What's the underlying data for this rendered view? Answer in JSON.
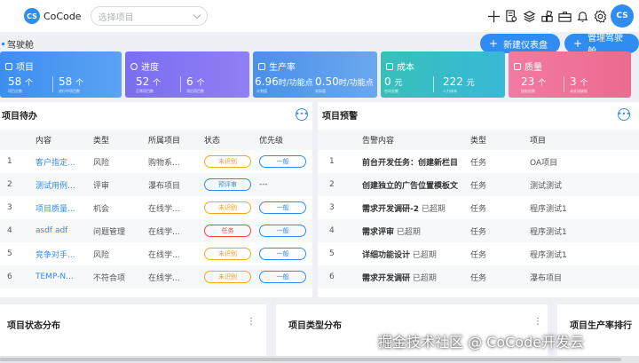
{
  "header": {
    "logo_mark": "CS",
    "app_name": "CoCode",
    "project_select_placeholder": "选择项目",
    "avatar_text": "CS"
  },
  "breadcrumb": {
    "title": "驾驶舱"
  },
  "actions": {
    "new_dashboard": "新建仪表盘",
    "manage_cockpit": "管理驾驶舱"
  },
  "stats": {
    "project": {
      "title": "项目",
      "v1": "58",
      "u1": "个",
      "s1": "项目总数",
      "v2": "58",
      "u2": "个",
      "s2": "进行中项目数"
    },
    "progress": {
      "title": "进度",
      "v1": "52",
      "u1": "个",
      "s1": "正常项目数",
      "v2": "6",
      "u2": "个",
      "s2": "滞后项目数"
    },
    "productivity": {
      "title": "生产率",
      "v1": "6.96",
      "u1": "时/功能点",
      "s1": "计划值",
      "v2": "0.50",
      "u2": "时/功能点",
      "s2": "实际值"
    },
    "cost": {
      "title": "成本",
      "v1": "0",
      "u1": "元",
      "s1": "合同金额",
      "v2": "222",
      "u2": "元",
      "s2": "人力成本"
    },
    "quality": {
      "title": "质量",
      "v1": "23",
      "u1": "个",
      "s1": "缺陷总数",
      "v2": "3",
      "u2": "个",
      "s2": "未关闭缺陷"
    }
  },
  "todo": {
    "title": "项目待办",
    "headers": [
      "内容",
      "类型",
      "所属项目",
      "状态",
      "优先级"
    ],
    "rows": [
      {
        "no": "1",
        "content": "客户指定...",
        "type": "风险",
        "project": "购物系...",
        "status": "未识别",
        "status_kind": "orange",
        "priority": "一般"
      },
      {
        "no": "2",
        "content": "测试用例...",
        "type": "评审",
        "project": "瀑布项目",
        "status": "预评审",
        "status_kind": "blue",
        "priority": "---"
      },
      {
        "no": "3",
        "content": "项目质量...",
        "type": "机会",
        "project": "在线学...",
        "status": "未识别",
        "status_kind": "orange",
        "priority": "一般"
      },
      {
        "no": "4",
        "content": "asdf adf",
        "type": "问题管理",
        "project": "在线学...",
        "status": "任务",
        "status_kind": "red",
        "priority": "一般"
      },
      {
        "no": "5",
        "content": "竞争对手...",
        "type": "风险",
        "project": "在线学...",
        "status": "未识别",
        "status_kind": "orange",
        "priority": "一般"
      },
      {
        "no": "6",
        "content": "TEMP-N...",
        "type": "不符合项",
        "project": "在线学...",
        "status": "未识别",
        "status_kind": "orange",
        "priority": "一般"
      }
    ]
  },
  "alerts": {
    "title": "项目预警",
    "headers": [
      "告警内容",
      "类型",
      "项目"
    ],
    "rows": [
      {
        "no": "1",
        "content": "前台开发任务：创建新栏目",
        "extra": "",
        "type": "任务",
        "project": "OA项目"
      },
      {
        "no": "2",
        "content": "创建独立的广告位置模板文",
        "extra": "",
        "type": "任务",
        "project": "测试测试"
      },
      {
        "no": "3",
        "content": "需求开发调研-2",
        "extra": "已超期",
        "type": "任务",
        "project": "程序测试1"
      },
      {
        "no": "4",
        "content": "需求评审",
        "extra": "已超期",
        "type": "任务",
        "project": "程序测试1"
      },
      {
        "no": "5",
        "content": "详细功能设计",
        "extra": "已超期",
        "type": "任务",
        "project": "程序测试1"
      },
      {
        "no": "6",
        "content": "需求开发调研",
        "extra": "已超期",
        "type": "任务",
        "project": "瀑布项目"
      }
    ]
  },
  "bottom": {
    "status_dist": "项目状态分布",
    "type_dist": "项目类型分布",
    "productivity_rank": "项目生产率排行"
  },
  "watermark": "掘金技术社区 @ CoCode开发云",
  "colors": {
    "accent": "#2f8cf0",
    "card_project": "#3d8ef0",
    "card_progress": "#7a6ff0",
    "card_productivity": "#4a90e8",
    "card_cost": "#39b8d8",
    "card_quality": "#f07fa0"
  }
}
